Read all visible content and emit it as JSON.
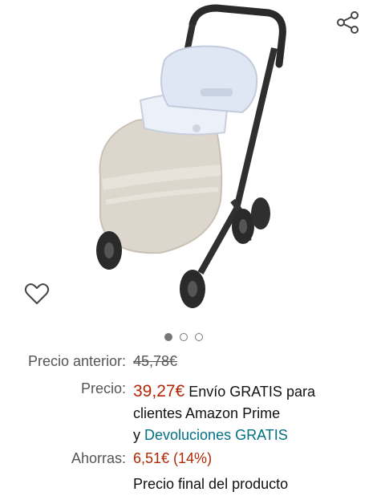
{
  "gallery": {
    "image_alt": "stroller with footmuff",
    "page_indicator": {
      "count": 3,
      "active": 1
    },
    "share_icon": "share-icon",
    "wishlist_icon": "heart-outline-icon"
  },
  "pricing": {
    "prev_label": "Precio anterior:",
    "prev_value": "45,78€",
    "price_label": "Precio:",
    "price_value": "39,27€",
    "shipping_text": " Envío GRATIS para",
    "shipping_line2": "clientes Amazon Prime",
    "returns_prefix": "y ",
    "returns_link": "Devoluciones GRATIS",
    "savings_label": "Ahorras:",
    "savings_value": "6,51€ (14%)",
    "final_note": "Precio final del producto"
  },
  "colors": {
    "price_red": "#b12704",
    "link_teal": "#007185",
    "label_gray": "#555555"
  }
}
